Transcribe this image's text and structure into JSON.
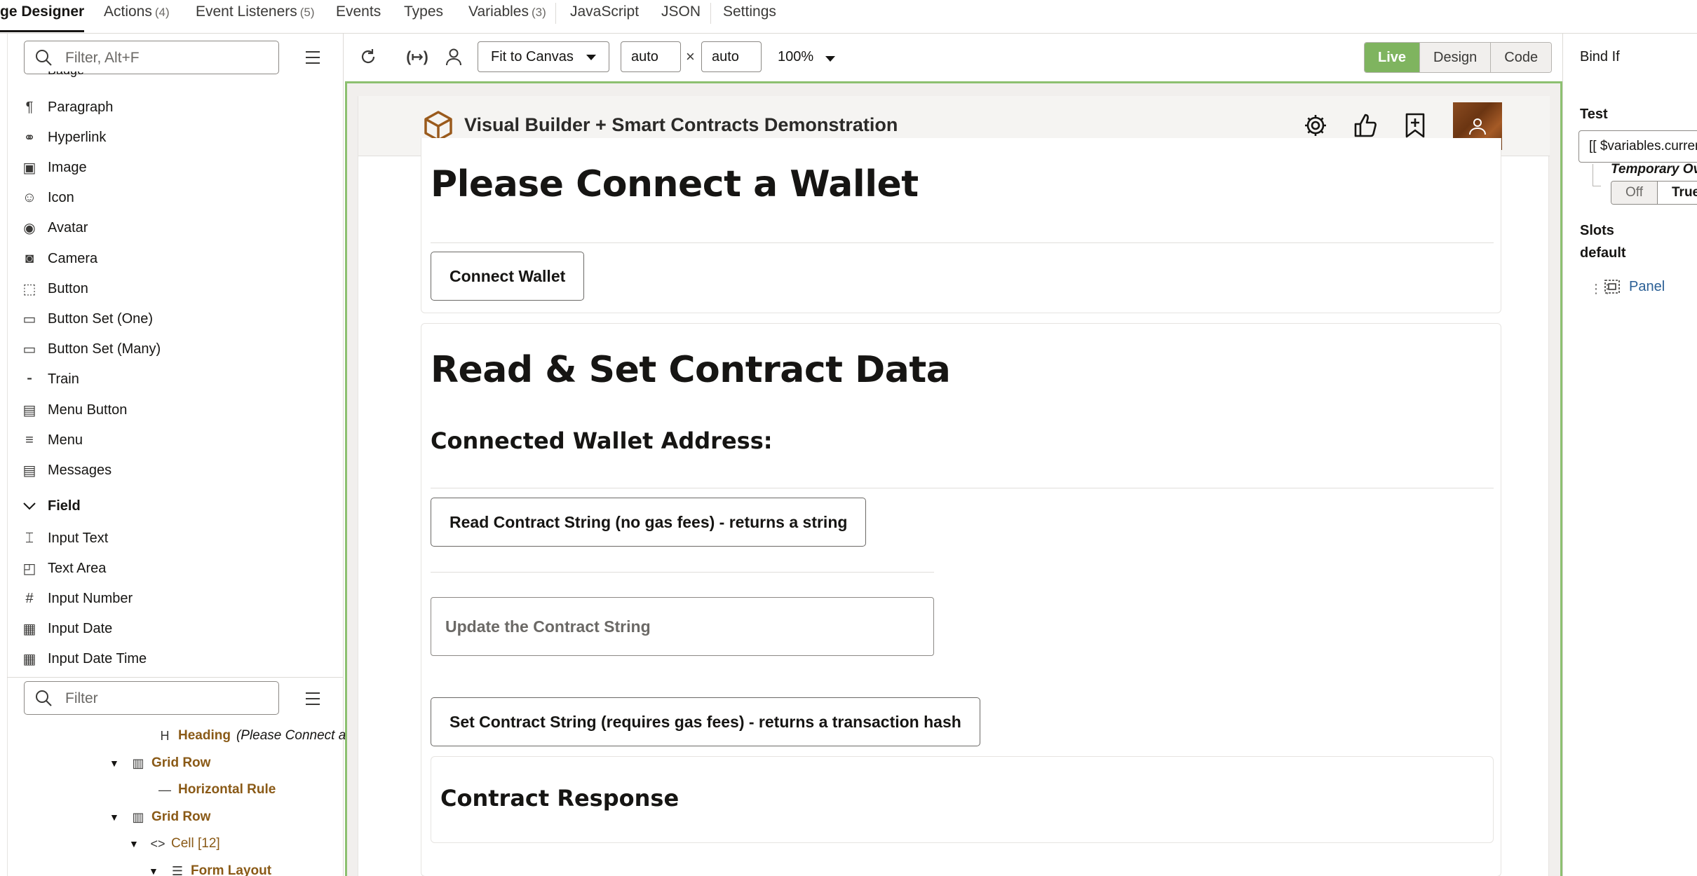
{
  "tabs": [
    {
      "label": "ge Designer",
      "count": "",
      "active": true
    },
    {
      "label": "Actions",
      "count": "(4)"
    },
    {
      "label": "Event Listeners",
      "count": "(5)"
    },
    {
      "label": "Events",
      "count": ""
    },
    {
      "label": "Types",
      "count": ""
    },
    {
      "label": "Variables",
      "count": "(3)"
    },
    {
      "label": "JavaScript",
      "count": ""
    },
    {
      "label": "JSON",
      "count": ""
    },
    {
      "label": "Settings",
      "count": ""
    }
  ],
  "left": {
    "search_placeholder": "Filter, Alt+F",
    "partial_item": "Badge",
    "components": [
      {
        "label": "Paragraph",
        "icon": "paragraph-icon",
        "glyph": "¶"
      },
      {
        "label": "Hyperlink",
        "icon": "link-icon",
        "glyph": "⚭"
      },
      {
        "label": "Image",
        "icon": "image-icon",
        "glyph": "▣"
      },
      {
        "label": "Icon",
        "icon": "icon-icon",
        "glyph": "☺"
      },
      {
        "label": "Avatar",
        "icon": "avatar-icon",
        "glyph": "◉"
      },
      {
        "label": "Camera",
        "icon": "camera-icon",
        "glyph": "◙"
      },
      {
        "label": "Button",
        "icon": "button-icon",
        "glyph": "⬚"
      },
      {
        "label": "Button Set (One)",
        "icon": "button-set-one-icon",
        "glyph": "▭"
      },
      {
        "label": "Button Set (Many)",
        "icon": "button-set-many-icon",
        "glyph": "▭"
      },
      {
        "label": "Train",
        "icon": "train-icon",
        "glyph": "⁃"
      },
      {
        "label": "Menu Button",
        "icon": "menu-button-icon",
        "glyph": "▤"
      },
      {
        "label": "Menu",
        "icon": "menu-icon",
        "glyph": "≡"
      },
      {
        "label": "Messages",
        "icon": "messages-icon",
        "glyph": "▤"
      }
    ],
    "section_field": "Field",
    "fields": [
      {
        "label": "Input Text",
        "icon": "input-text-icon",
        "glyph": "⌶"
      },
      {
        "label": "Text Area",
        "icon": "text-area-icon",
        "glyph": "◰"
      },
      {
        "label": "Input Number",
        "icon": "input-number-icon",
        "glyph": "#"
      },
      {
        "label": "Input Date",
        "icon": "input-date-icon",
        "glyph": "▦"
      },
      {
        "label": "Input Date Time",
        "icon": "input-date-time-icon",
        "glyph": "▦"
      }
    ],
    "structure_filter_placeholder": "Filter",
    "tree": [
      {
        "label": "Heading",
        "detail": "(Please Connect a",
        "icon": "heading-icon",
        "glyph": "H",
        "twisty": ""
      },
      {
        "label": "Grid Row",
        "detail": "",
        "icon": "grid-row-icon",
        "glyph": "▥",
        "twisty": "▼"
      },
      {
        "label": "Horizontal Rule",
        "detail": "",
        "icon": "horizontal-rule-icon",
        "glyph": "—",
        "twisty": ""
      },
      {
        "label": "Grid Row",
        "detail": "",
        "icon": "grid-row-icon",
        "glyph": "▥",
        "twisty": "▼"
      },
      {
        "label": "Cell [12]",
        "detail": "",
        "icon": "cell-icon",
        "glyph": "<>",
        "twisty": "▼"
      },
      {
        "label": "Form Layout",
        "detail": "",
        "icon": "form-layout-icon",
        "glyph": "☰",
        "twisty": "▼"
      }
    ]
  },
  "toolbar": {
    "fit_label": "Fit to Canvas",
    "width_value": "auto",
    "height_value": "auto",
    "times": "×",
    "zoom": "100%",
    "modes": [
      "Live",
      "Design",
      "Code"
    ],
    "active_mode": "Live"
  },
  "app": {
    "title": "Visual Builder + Smart Contracts Demonstration",
    "connect_heading": "Please Connect a Wallet",
    "connect_button": "Connect Wallet",
    "read_heading": "Read & Set Contract Data",
    "wallet_address_label": "Connected Wallet Address:",
    "read_button": "Read Contract String (no gas fees) - returns a string",
    "update_placeholder": "Update the Contract String",
    "set_button": "Set Contract String (requires gas fees) - returns a transaction hash",
    "response_heading": "Contract Response"
  },
  "right": {
    "title": "Bind If",
    "test_label": "Test",
    "test_value": "[[ $variables.currentAccount",
    "temporary_label": "Temporary Override",
    "seg": [
      "Off",
      "True"
    ],
    "slots_label": "Slots",
    "default_label": "default",
    "panel_link": "Panel"
  },
  "colors": {
    "live_green": "#7fb45f",
    "canvas_border": "#8cc070",
    "tree_label": "#8a5a17",
    "link_blue": "#2a5f95",
    "logo_brown": "#9a5a1c"
  }
}
